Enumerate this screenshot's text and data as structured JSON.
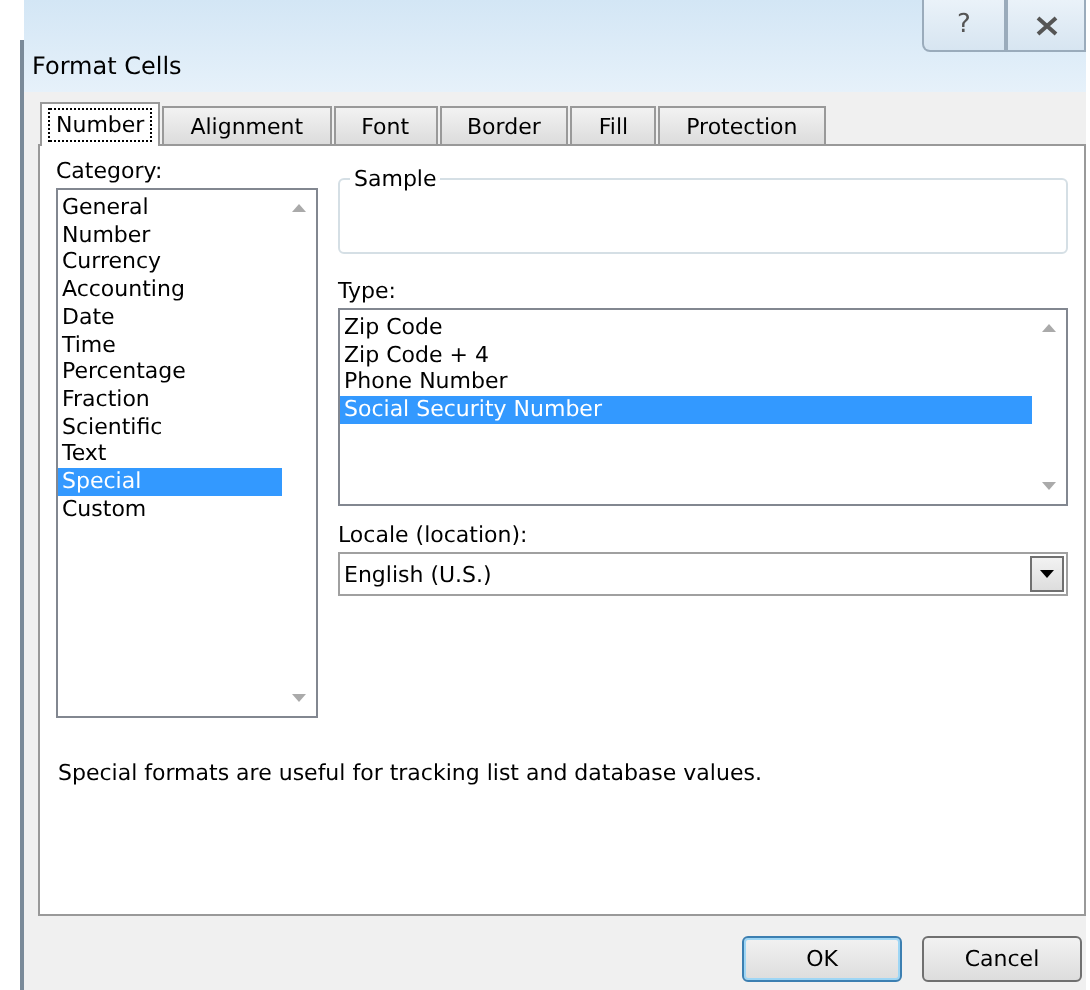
{
  "window": {
    "title": "Format Cells",
    "controls": [
      "?"
    ]
  },
  "tabs": [
    {
      "label": "Number",
      "selected": true
    },
    {
      "label": "Alignment",
      "selected": false
    },
    {
      "label": "Font",
      "selected": false
    },
    {
      "label": "Border",
      "selected": false
    },
    {
      "label": "Fill",
      "selected": false
    },
    {
      "label": "Protection",
      "selected": false
    }
  ],
  "category": {
    "label": "Category:",
    "items": [
      {
        "label": "General",
        "selected": false
      },
      {
        "label": "Number",
        "selected": false
      },
      {
        "label": "Currency",
        "selected": false
      },
      {
        "label": "Accounting",
        "selected": false
      },
      {
        "label": "Date",
        "selected": false
      },
      {
        "label": "Time",
        "selected": false
      },
      {
        "label": "Percentage",
        "selected": false
      },
      {
        "label": "Fraction",
        "selected": false
      },
      {
        "label": "Scientific",
        "selected": false
      },
      {
        "label": "Text",
        "selected": false
      },
      {
        "label": "Special",
        "selected": true
      },
      {
        "label": "Custom",
        "selected": false
      }
    ]
  },
  "sample": {
    "label": "Sample"
  },
  "type": {
    "label": "Type:",
    "items": [
      {
        "label": "Zip Code",
        "selected": false
      },
      {
        "label": "Zip Code + 4",
        "selected": false
      },
      {
        "label": "Phone Number",
        "selected": false
      },
      {
        "label": "Social Security Number",
        "selected": true
      }
    ]
  },
  "locale": {
    "label": "Locale (location):",
    "value": "English (U.S.)"
  },
  "description": "Special formats are useful for tracking list and database values.",
  "buttons": [
    {
      "label": "OK",
      "default": true
    },
    {
      "label": "Cancel",
      "default": false
    }
  ]
}
